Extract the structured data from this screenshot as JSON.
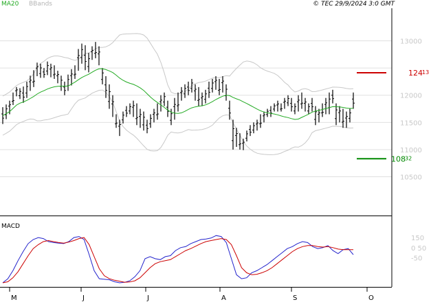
{
  "header": {
    "ma_label": "MA20",
    "bbands_label": "BBands",
    "copyright": "© TEC 29/9/2024 3:0 GMT"
  },
  "colors": {
    "price_bars": "#000000",
    "ma20": "#22aa22",
    "bbands": "#c8c8c8",
    "resistance": "#cc0000",
    "support": "#008800",
    "macd_line": "#2222cc",
    "signal_line": "#cc0000",
    "grid": "#e0e0e0"
  },
  "chart_data": [
    {
      "type": "ohlc",
      "panel": "price",
      "overlays": [
        "MA20",
        "BBands"
      ],
      "ylim": [
        9800,
        13600
      ],
      "yticks": [
        10500,
        11000,
        11500,
        12000,
        12500,
        13000
      ],
      "ytick_labels": [
        "10500",
        "11000",
        "11500",
        "12000",
        "",
        "13000"
      ],
      "months": [
        "M",
        "J",
        "J",
        "A",
        "S",
        "O"
      ],
      "levels": [
        {
          "name": "resistance",
          "main": "124",
          "decimals": "13",
          "value": 12413
        },
        {
          "name": "support",
          "main": "108",
          "decimals": "32",
          "value": 10832
        }
      ],
      "bars": [
        {
          "h": 11780,
          "l": 11470
        },
        {
          "h": 11830,
          "l": 11560
        },
        {
          "h": 11900,
          "l": 11650
        },
        {
          "h": 12050,
          "l": 11820
        },
        {
          "h": 12150,
          "l": 11980
        },
        {
          "h": 12130,
          "l": 11930
        },
        {
          "h": 12160,
          "l": 11860
        },
        {
          "h": 12250,
          "l": 11950
        },
        {
          "h": 12360,
          "l": 12080
        },
        {
          "h": 12460,
          "l": 12150
        },
        {
          "h": 12600,
          "l": 12350
        },
        {
          "h": 12580,
          "l": 12320
        },
        {
          "h": 12500,
          "l": 12320
        },
        {
          "h": 12620,
          "l": 12370
        },
        {
          "h": 12580,
          "l": 12330
        },
        {
          "h": 12550,
          "l": 12300
        },
        {
          "h": 12450,
          "l": 12220
        },
        {
          "h": 12360,
          "l": 12080
        },
        {
          "h": 12250,
          "l": 12000
        },
        {
          "h": 12380,
          "l": 12080
        },
        {
          "h": 12480,
          "l": 12180
        },
        {
          "h": 12550,
          "l": 12300
        },
        {
          "h": 12850,
          "l": 12450
        },
        {
          "h": 12950,
          "l": 12580
        },
        {
          "h": 12920,
          "l": 12460
        },
        {
          "h": 12780,
          "l": 12420
        },
        {
          "h": 12900,
          "l": 12650
        },
        {
          "h": 12980,
          "l": 12680
        },
        {
          "h": 12900,
          "l": 12550
        },
        {
          "h": 12500,
          "l": 12200
        },
        {
          "h": 12350,
          "l": 11950
        },
        {
          "h": 12200,
          "l": 11750
        },
        {
          "h": 12000,
          "l": 11600
        },
        {
          "h": 11650,
          "l": 11400
        },
        {
          "h": 11550,
          "l": 11250
        },
        {
          "h": 11700,
          "l": 11480
        },
        {
          "h": 11800,
          "l": 11600
        },
        {
          "h": 11850,
          "l": 11650
        },
        {
          "h": 11900,
          "l": 11600
        },
        {
          "h": 11850,
          "l": 11450
        },
        {
          "h": 11750,
          "l": 11400
        },
        {
          "h": 11700,
          "l": 11350
        },
        {
          "h": 11550,
          "l": 11300
        },
        {
          "h": 11650,
          "l": 11400
        },
        {
          "h": 11750,
          "l": 11500
        },
        {
          "h": 11850,
          "l": 11550
        },
        {
          "h": 12000,
          "l": 11700
        },
        {
          "h": 12050,
          "l": 11800
        },
        {
          "h": 11900,
          "l": 11600
        },
        {
          "h": 11750,
          "l": 11450
        },
        {
          "h": 11950,
          "l": 11550
        },
        {
          "h": 12050,
          "l": 11700
        },
        {
          "h": 12150,
          "l": 11900
        },
        {
          "h": 12200,
          "l": 11950
        },
        {
          "h": 12250,
          "l": 12000
        },
        {
          "h": 12300,
          "l": 12050
        },
        {
          "h": 12200,
          "l": 11900
        },
        {
          "h": 12150,
          "l": 11800
        },
        {
          "h": 12050,
          "l": 11800
        },
        {
          "h": 12100,
          "l": 11850
        },
        {
          "h": 12250,
          "l": 11950
        },
        {
          "h": 12300,
          "l": 12050
        },
        {
          "h": 12350,
          "l": 12100
        },
        {
          "h": 12300,
          "l": 12000
        },
        {
          "h": 12350,
          "l": 12050
        },
        {
          "h": 12200,
          "l": 11900
        },
        {
          "h": 11900,
          "l": 11550
        },
        {
          "h": 11550,
          "l": 11000
        },
        {
          "h": 11400,
          "l": 11050
        },
        {
          "h": 11300,
          "l": 11000
        },
        {
          "h": 11200,
          "l": 10990
        },
        {
          "h": 11350,
          "l": 11150
        },
        {
          "h": 11450,
          "l": 11250
        },
        {
          "h": 11500,
          "l": 11300
        },
        {
          "h": 11550,
          "l": 11350
        },
        {
          "h": 11650,
          "l": 11400
        },
        {
          "h": 11700,
          "l": 11500
        },
        {
          "h": 11750,
          "l": 11600
        },
        {
          "h": 11800,
          "l": 11600
        },
        {
          "h": 11850,
          "l": 11700
        },
        {
          "h": 11900,
          "l": 11700
        },
        {
          "h": 11850,
          "l": 11700
        },
        {
          "h": 11950,
          "l": 11750
        },
        {
          "h": 12000,
          "l": 11800
        },
        {
          "h": 11950,
          "l": 11700
        },
        {
          "h": 11850,
          "l": 11650
        },
        {
          "h": 12000,
          "l": 11700
        },
        {
          "h": 12050,
          "l": 11750
        },
        {
          "h": 11950,
          "l": 11700
        },
        {
          "h": 11850,
          "l": 11650
        },
        {
          "h": 11950,
          "l": 11700
        },
        {
          "h": 11800,
          "l": 11450
        },
        {
          "h": 11750,
          "l": 11500
        },
        {
          "h": 11850,
          "l": 11600
        },
        {
          "h": 11950,
          "l": 11650
        },
        {
          "h": 12050,
          "l": 11650
        },
        {
          "h": 12100,
          "l": 11850
        },
        {
          "h": 11850,
          "l": 11450
        },
        {
          "h": 11800,
          "l": 11500
        },
        {
          "h": 11750,
          "l": 11400
        },
        {
          "h": 11700,
          "l": 11400
        },
        {
          "h": 11750,
          "l": 11500
        },
        {
          "h": 12050,
          "l": 11750
        }
      ]
    },
    {
      "type": "line",
      "panel": "macd",
      "title": "MACD",
      "ylim": [
        -300,
        260
      ],
      "yticks": [
        150,
        50,
        -50
      ],
      "ytick_labels": [
        "150",
        "0 50",
        "-50"
      ],
      "series": [
        {
          "key": "macd",
          "values": [
            -300,
            -260,
            -180,
            -80,
            10,
            90,
            130,
            150,
            140,
            110,
            100,
            95,
            90,
            110,
            150,
            160,
            130,
            -20,
            -180,
            -260,
            -265,
            -270,
            -290,
            -300,
            -295,
            -280,
            -240,
            -180,
            -60,
            -40,
            -60,
            -70,
            -40,
            -30,
            20,
            50,
            60,
            90,
            110,
            130,
            135,
            145,
            170,
            160,
            100,
            -60,
            -220,
            -260,
            -250,
            -200,
            -180,
            -150,
            -120,
            -80,
            -40,
            0,
            40,
            60,
            90,
            110,
            100,
            60,
            40,
            50,
            70,
            20,
            -10,
            30,
            40,
            -20
          ]
        },
        {
          "key": "signal",
          "values": [
            -300,
            -290,
            -250,
            -190,
            -110,
            -30,
            40,
            80,
            110,
            120,
            110,
            100,
            95,
            105,
            120,
            140,
            150,
            80,
            -40,
            -160,
            -230,
            -260,
            -275,
            -285,
            -295,
            -292,
            -280,
            -250,
            -200,
            -150,
            -110,
            -90,
            -80,
            -70,
            -40,
            -10,
            20,
            40,
            65,
            90,
            110,
            120,
            130,
            140,
            130,
            80,
            -30,
            -150,
            -200,
            -220,
            -215,
            -200,
            -180,
            -150,
            -110,
            -70,
            -30,
            10,
            40,
            60,
            70,
            70,
            60,
            55,
            60,
            50,
            35,
            30,
            30,
            30
          ]
        }
      ]
    }
  ]
}
